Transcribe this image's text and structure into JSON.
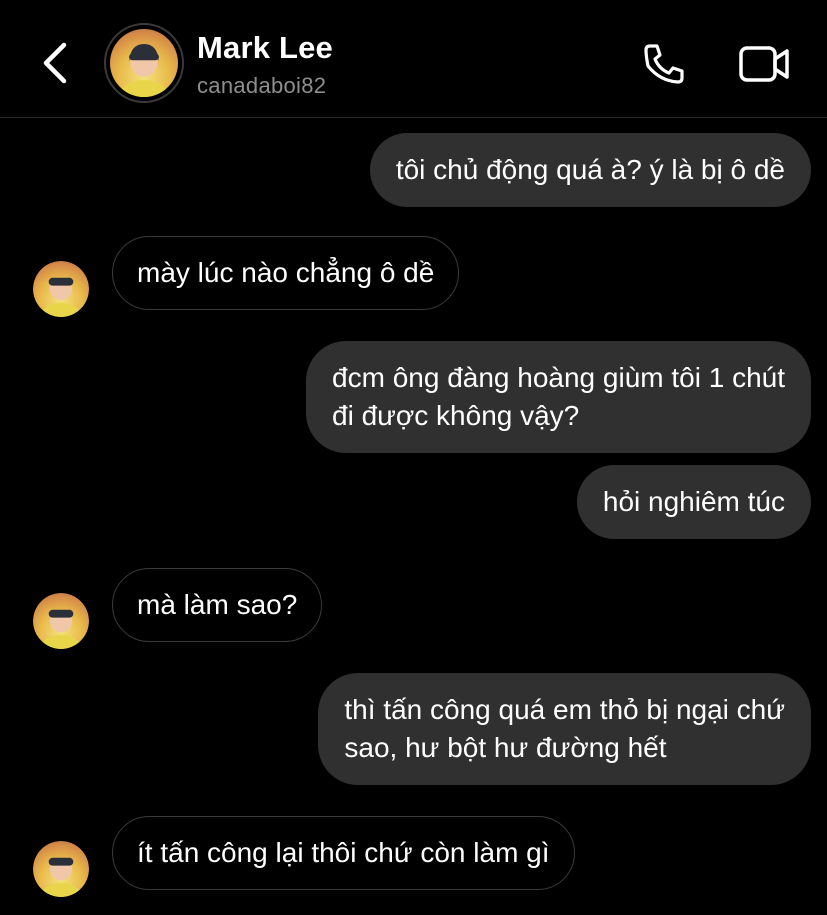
{
  "header": {
    "name": "Mark Lee",
    "username": "canadaboi82",
    "icons": {
      "back": "chevron-left-icon",
      "call": "phone-icon",
      "video": "video-camera-icon"
    }
  },
  "messages": [
    {
      "direction": "sent",
      "text": "tôi chủ động quá à? ý là bị ô dề"
    },
    {
      "direction": "received",
      "text": "mày lúc nào chẳng ô dề"
    },
    {
      "direction": "sent",
      "lines": [
        "đcm ông đàng hoàng giùm tôi 1 chút",
        "đi được không vậy?"
      ]
    },
    {
      "direction": "sent",
      "text": "hỏi nghiêm túc"
    },
    {
      "direction": "received",
      "text": "mà làm sao?"
    },
    {
      "direction": "sent",
      "lines": [
        "thì tấn công quá em thỏ bị ngại chứ",
        "sao, hư bột hư đường hết"
      ]
    },
    {
      "direction": "received",
      "text": "ít tấn công lại thôi chứ còn làm gì"
    }
  ],
  "colors": {
    "background": "#000000",
    "sent_bubble": "#303030",
    "received_border": "#3a3a3a",
    "secondary_text": "#8e8e8e"
  }
}
